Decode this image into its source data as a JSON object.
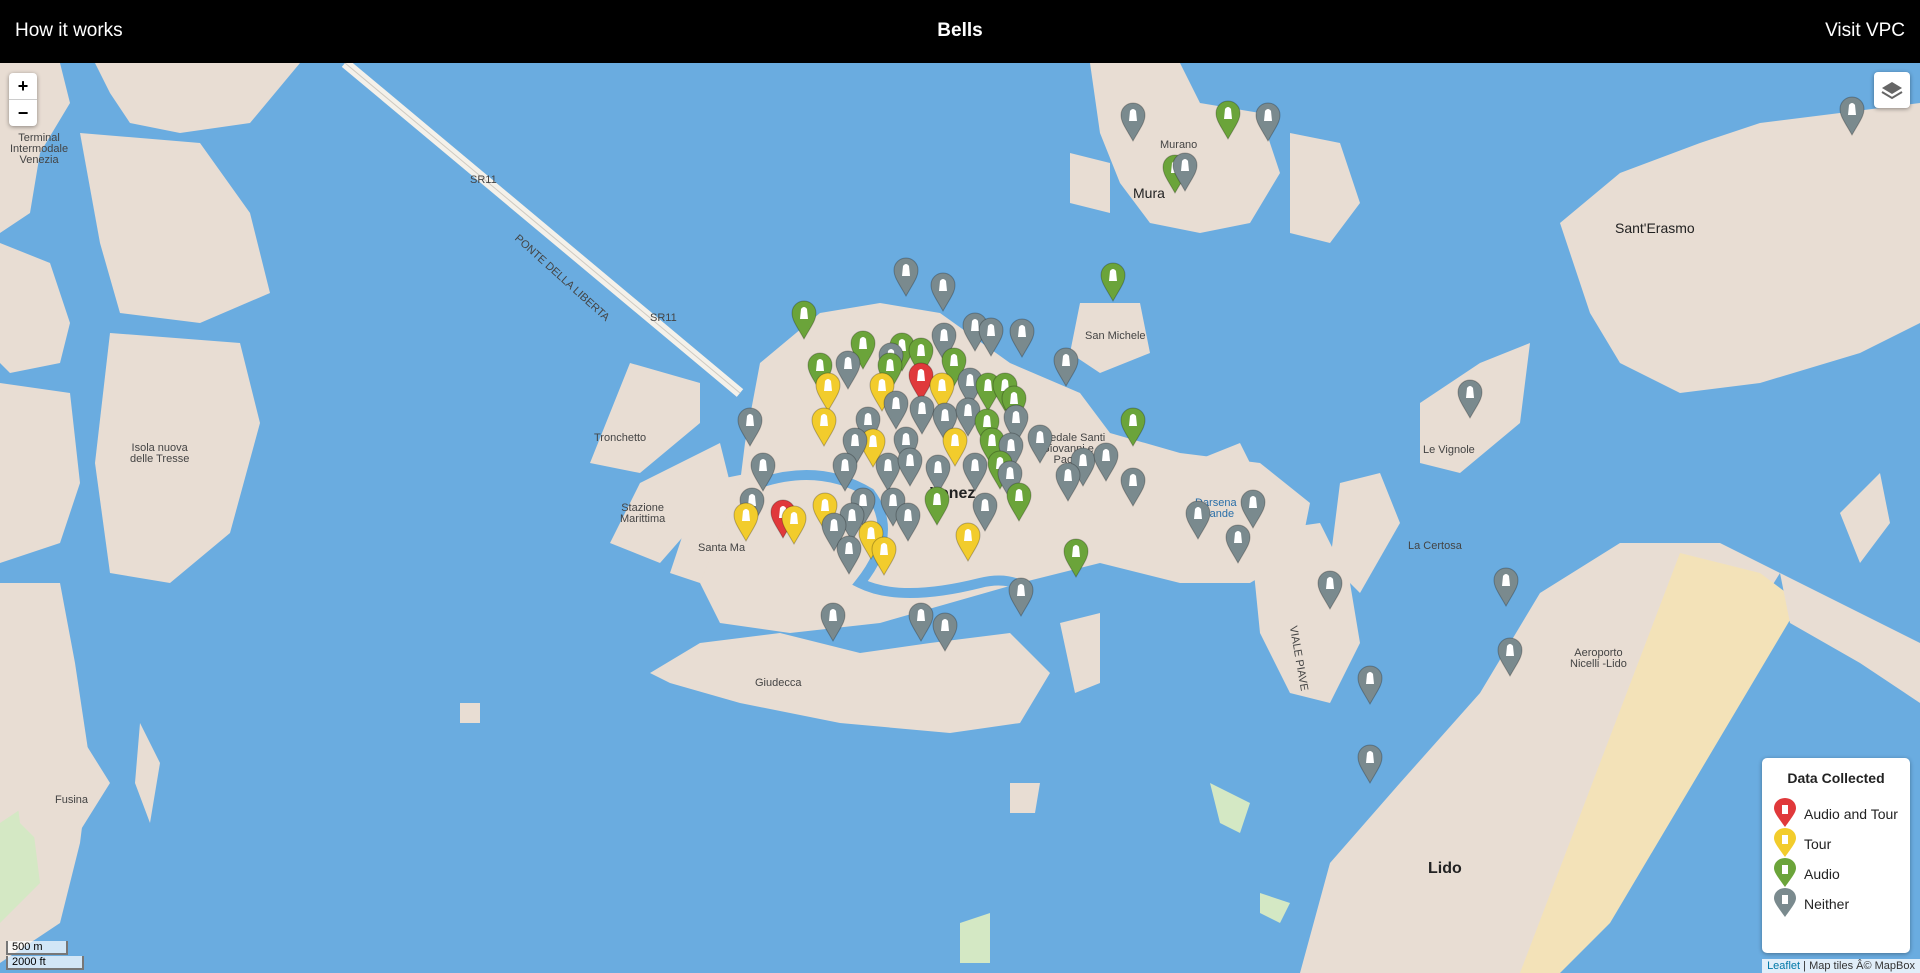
{
  "header": {
    "left_link": "How it works",
    "title": "Bells",
    "right_link": "Visit VPC"
  },
  "map": {
    "zoom_in": "+",
    "zoom_out": "−",
    "scale_metric": "500 m",
    "scale_imperial": "2000 ft",
    "attribution_link": "Leaflet",
    "attribution_text": " | Map tiles Â© MapBox",
    "place_labels": {
      "terminal": "Terminal\nIntermodale\nVenezia",
      "sr11_a": "SR11",
      "ponte": "PONTE DELLA LIBERTA",
      "sr11_b": "SR11",
      "isola_tresse": "Isola nuova\ndelle Tresse",
      "tronchetto": "Tronchetto",
      "stazione": "Stazione\nMarittima",
      "santa_marta": "Santa Ma",
      "giudecca": "Giudecca",
      "venezia": "Venez",
      "ospedale": "Ospedale Santi\nGiovanni e\nPaolo",
      "murano_small": "Murano",
      "murano": "Mura",
      "san_michele": "San Michele",
      "santerasmo": "Sant'Erasmo",
      "vignole": "Le Vignole",
      "certosa": "La Certosa",
      "darsena": "Darsena\nGrande",
      "viale_piave": "VIALE PIAVE",
      "aeroporto": "Aeroporto\nNicelli -Lido",
      "lido": "Lido",
      "fusina": "Fusina"
    }
  },
  "legend": {
    "title": "Data Collected",
    "items": [
      {
        "label": "Audio and Tour",
        "color": "#e0393b"
      },
      {
        "label": "Tour",
        "color": "#f2cc2c"
      },
      {
        "label": "Audio",
        "color": "#6ba43a"
      },
      {
        "label": "Neither",
        "color": "#7a8a8e"
      }
    ]
  },
  "icons": {
    "layers": "layers-icon",
    "pin": "bell-marker-icon"
  }
}
